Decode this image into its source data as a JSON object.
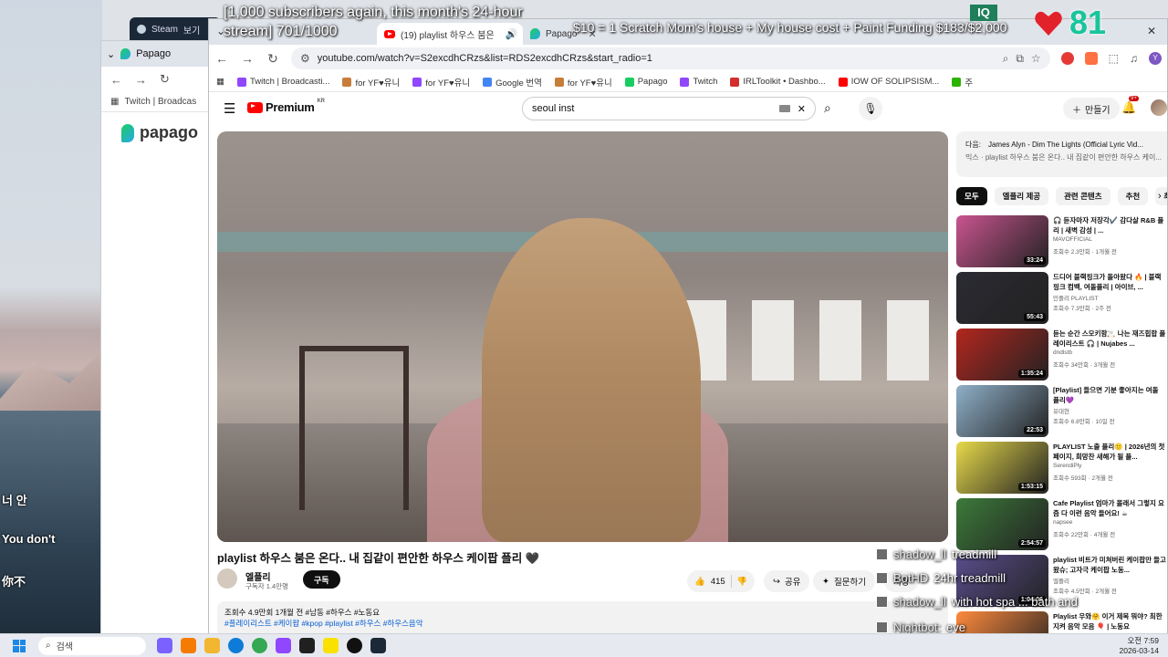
{
  "overlay": {
    "goal_text": "[1,000 subscribers again, this month's 24-hour stream] 701/1000",
    "funding_text": "$10 = 1 Scratch Mom's house + My house cost + Paint Funding $183/$2,000",
    "heart_count": "81",
    "logo_text": "IQ",
    "subtitles": [
      "너 안",
      "You don't",
      "你不"
    ],
    "chat": [
      {
        "user": "shadow_ll",
        "msg": "treadmill"
      },
      {
        "user": "BotHD",
        "msg": "24hr treadmill"
      },
      {
        "user": "shadow_ll",
        "msg": "with hot spa ... bath and"
      },
      {
        "user": "Nightbot:",
        "msg": "eve"
      }
    ]
  },
  "back_window": {
    "tab_label": "Papago",
    "bookmark_label": "Twitch | Broadcas",
    "logo_text": "papago",
    "steam_tab_label": "Steam",
    "steam_extra": "보기"
  },
  "browser": {
    "tabs": [
      {
        "label": "(19) playlist 하우스 붐은",
        "active": true
      },
      {
        "label": "Papago",
        "active": false
      }
    ],
    "url": "youtube.com/watch?v=S2excdhCRzs&list=RDS2excdhCRzs&start_radio=1",
    "bookmarks": [
      "Twitch | Broadcasti...",
      "for YF♥유니",
      "for YF♥유니",
      "Google 번역",
      "for YF♥유니",
      "Papago",
      "Twitch",
      "IRLToolkit • Dashbo...",
      "IOW OF SOLIPSISM...",
      "주"
    ],
    "profile_initial": "Y"
  },
  "youtube": {
    "logo": "Premium",
    "region": "KR",
    "search_query": "seoul inst",
    "create_label": "만들기",
    "notif_badge": "9+",
    "video_title": "playlist 하우스 붐은 온다.. 내 집같이 편안한 하우스 케이팝 플리 🖤",
    "channel_name": "엘플리",
    "channel_subs": "구독자 1.4만명",
    "subscribe_label": "구독",
    "likes": "415",
    "share_label": "공유",
    "ask_label": "질문하기",
    "save_label": "저장",
    "desc_meta": "조회수 4.9만회  1개월 전  #남동 #하우스 #노동요",
    "desc_tags": "#플레이리스트 #케이팝 #kpop #playlist #하우스 #하우스음악",
    "up_next_prefix": "다음:",
    "up_next_title": "James Alyn - Dim The Lights (Official Lyric Vid...",
    "up_next_sub": "믹스 · playlist 하우스 붐은 온다.. 내 집같이 편안한 하우스 케이...",
    "chips": [
      "모두",
      "엘플리 제공",
      "관련 콘텐츠",
      "추천",
      "최"
    ],
    "recommendations": [
      {
        "title": "🎧 듣자마자 저장각✔️ 감다살 R&B 플리 | 새벽 감성 | ...",
        "channel": "MAVOFFICIAL",
        "views": "조회수 2.3만회 · 1개월 전",
        "duration": "33:24",
        "thumb": "#c9548f"
      },
      {
        "title": "드디어 블랙핑크가 돌아왔다 🔥 | 블랙핑크 컴백, 여돌플리 | 아이브, ...",
        "channel": "민플리 PLAYLIST",
        "views": "조회수 7.3만회 · 2주 전",
        "duration": "55:43",
        "thumb": "#2b2b33"
      },
      {
        "title": "듣는 순간 스모키함🚬 나는 재즈힙합 플레이리스트 🎧 | Nujabes ...",
        "channel": "dndlstb",
        "views": "조회수 34만회 · 3개월 전",
        "duration": "1:35:24",
        "thumb": "#b3261e"
      },
      {
        "title": "[Playlist] 들으면 기분 좋아지는 여돌 플리💜",
        "channel": "유대현",
        "views": "조회수 6.8만회 · 10일 전",
        "duration": "22:53",
        "thumb": "#8fb0c9"
      },
      {
        "title": "PLAYLIST 노출 플리🙂 | 2026년의 첫 페이지, 희망찬 새해가 될 플...",
        "channel": "SerendiPly",
        "views": "조회수 593회 · 2개월 전",
        "duration": "1:53:15",
        "thumb": "#e7d94a"
      },
      {
        "title": "Cafe Playlist 엄마가 몰래서 그렇지 요즘 다 이런 음악 들어요! ☕",
        "channel": "napsee",
        "views": "조회수 22만회 · 4개월 전",
        "duration": "2:54:57",
        "thumb": "#3c7a3a"
      },
      {
        "title": "playlist 비트가 미쳐버린 케이팝만 들고왔슈; 고자극 케이팝 노동...",
        "channel": "엘플리",
        "views": "조회수 4.5만회 · 2개월 전",
        "duration": "1:04:06",
        "thumb": "#5a4d8c"
      },
      {
        "title": "Playlist 우와🤗 이거 제목 뭐야? 최한지켜 음악 모음 🎈 | 노동요",
        "channel": "",
        "views": "",
        "duration": "",
        "thumb": "#ff8a3d"
      }
    ]
  },
  "taskbar": {
    "search_placeholder": "검색",
    "time": "오전 7:59",
    "date": "2026-03-14"
  }
}
